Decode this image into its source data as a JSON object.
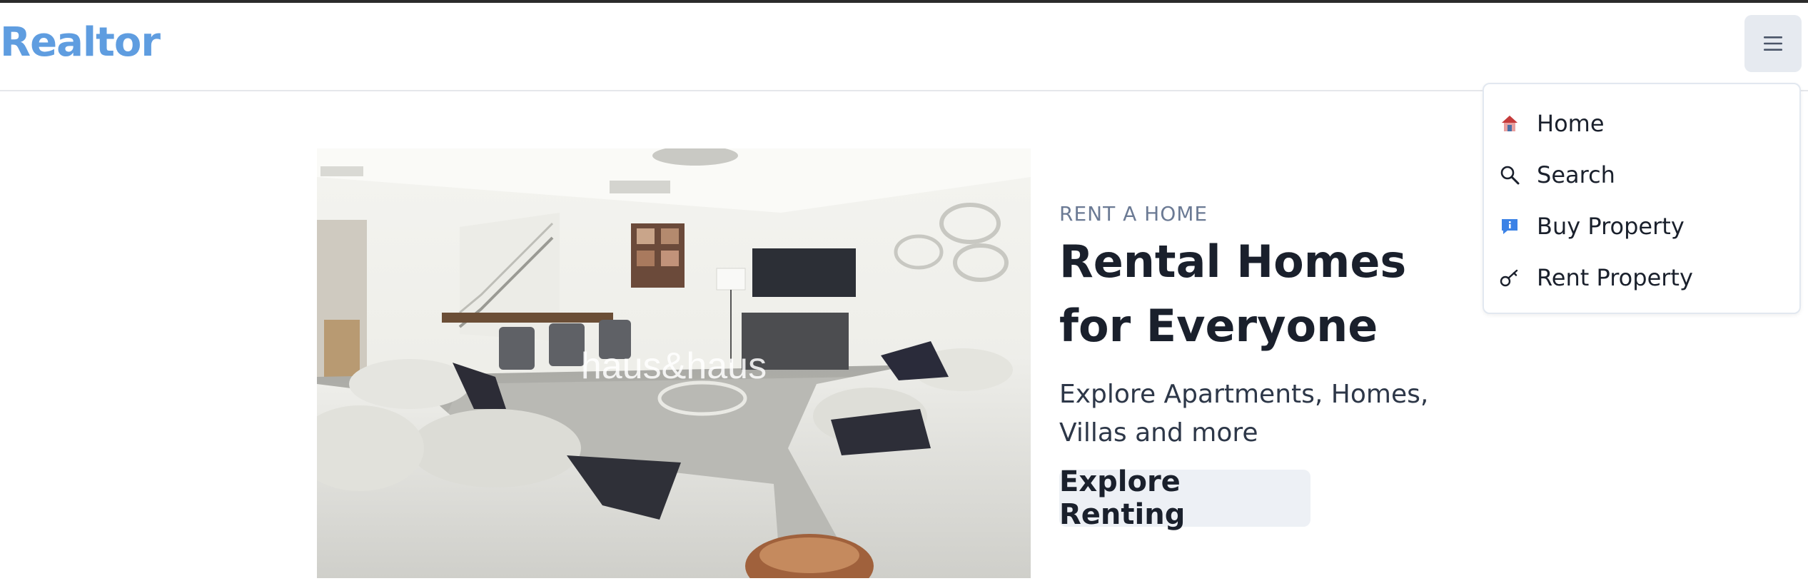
{
  "brand": {
    "name": "Realtor"
  },
  "header": {
    "menu_icon": "hamburger-icon"
  },
  "menu": {
    "items": [
      {
        "label": "Home",
        "icon": "house-icon"
      },
      {
        "label": "Search",
        "icon": "search-icon"
      },
      {
        "label": "Buy Property",
        "icon": "info-badge-icon"
      },
      {
        "label": "Rent Property",
        "icon": "key-icon"
      }
    ]
  },
  "hero": {
    "watermark": "haus&haus",
    "eyebrow": "RENT A HOME",
    "title": "Rental Homes for Everyone",
    "description": "Explore Apartments, Homes, Villas and more",
    "cta_label": "Explore Renting"
  },
  "colors": {
    "brand": "#5f9de0",
    "menu_button_bg": "#e6eaf0",
    "cta_bg": "#edf0f5",
    "eyebrow": "#6b7a94"
  }
}
